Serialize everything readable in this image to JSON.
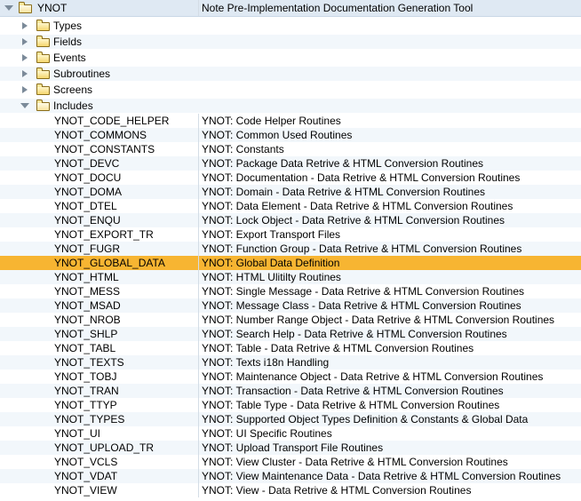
{
  "header": {
    "name": "YNOT",
    "description": "Note Pre-Implementation Documentation Generation Tool"
  },
  "folders": [
    {
      "label": "Types",
      "expanded": false
    },
    {
      "label": "Fields",
      "expanded": false
    },
    {
      "label": "Events",
      "expanded": false
    },
    {
      "label": "Subroutines",
      "expanded": false
    },
    {
      "label": "Screens",
      "expanded": false
    },
    {
      "label": "Includes",
      "expanded": true
    }
  ],
  "includes": [
    {
      "name": "YNOT_CODE_HELPER",
      "description": "YNOT: Code Helper Routines"
    },
    {
      "name": "YNOT_COMMONS",
      "description": "YNOT: Common Used Routines"
    },
    {
      "name": "YNOT_CONSTANTS",
      "description": "YNOT: Constants"
    },
    {
      "name": "YNOT_DEVC",
      "description": "YNOT: Package Data Retrive & HTML Conversion Routines"
    },
    {
      "name": "YNOT_DOCU",
      "description": "YNOT: Documentation - Data Retrive & HTML Conversion Routines"
    },
    {
      "name": "YNOT_DOMA",
      "description": "YNOT: Domain - Data Retrive & HTML Conversion Routines"
    },
    {
      "name": "YNOT_DTEL",
      "description": "YNOT: Data Element - Data Retrive & HTML Conversion Routines"
    },
    {
      "name": "YNOT_ENQU",
      "description": "YNOT: Lock Object - Data Retrive & HTML Conversion Routines"
    },
    {
      "name": "YNOT_EXPORT_TR",
      "description": "YNOT: Export Transport Files"
    },
    {
      "name": "YNOT_FUGR",
      "description": "YNOT: Function Group - Data Retrive & HTML Conversion Routines"
    },
    {
      "name": "YNOT_GLOBAL_DATA",
      "description": "YNOT: Global Data Definition",
      "selected": true
    },
    {
      "name": "YNOT_HTML",
      "description": "YNOT: HTML Ulitilty Routines"
    },
    {
      "name": "YNOT_MESS",
      "description": "YNOT: Single Message - Data Retrive & HTML Conversion Routines"
    },
    {
      "name": "YNOT_MSAD",
      "description": "YNOT: Message Class - Data Retrive & HTML Conversion Routines"
    },
    {
      "name": "YNOT_NROB",
      "description": "YNOT: Number Range Object - Data Retrive & HTML Conversion Routines"
    },
    {
      "name": "YNOT_SHLP",
      "description": "YNOT: Search Help - Data Retrive & HTML Conversion Routines"
    },
    {
      "name": "YNOT_TABL",
      "description": "YNOT: Table - Data Retrive & HTML Conversion Routines"
    },
    {
      "name": "YNOT_TEXTS",
      "description": "YNOT: Texts i18n Handling"
    },
    {
      "name": "YNOT_TOBJ",
      "description": "YNOT: Maintenance Object - Data Retrive & HTML Conversion Routines"
    },
    {
      "name": "YNOT_TRAN",
      "description": "YNOT: Transaction - Data Retrive & HTML Conversion Routines"
    },
    {
      "name": "YNOT_TTYP",
      "description": "YNOT: Table Type - Data Retrive & HTML Conversion Routines"
    },
    {
      "name": "YNOT_TYPES",
      "description": "YNOT: Supported Object Types Definition & Constants & Global Data"
    },
    {
      "name": "YNOT_UI",
      "description": "YNOT: UI Specific Routines"
    },
    {
      "name": "YNOT_UPLOAD_TR",
      "description": "YNOT: Upload Transport File Routines"
    },
    {
      "name": "YNOT_VCLS",
      "description": "YNOT: View Cluster - Data Retrive & HTML Conversion Routines"
    },
    {
      "name": "YNOT_VDAT",
      "description": "YNOT: View Maintenance Data - Data Retrive & HTML Conversion Routines"
    },
    {
      "name": "YNOT_VIEW",
      "description": "YNOT: View - Data Retrive & HTML Conversion Routines"
    }
  ],
  "colors": {
    "selected": "#f7b532",
    "header": "#dfe9f3",
    "alt_row": "#f2f7fb"
  }
}
